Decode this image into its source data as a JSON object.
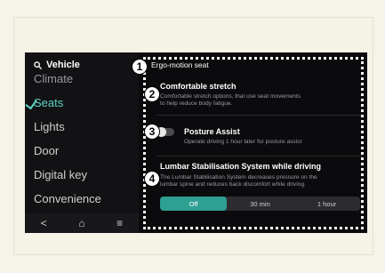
{
  "sidebar": {
    "header": "Vehicle",
    "items": [
      {
        "label": "Climate",
        "active": false
      },
      {
        "label": "Seats",
        "active": true
      },
      {
        "label": "Lights",
        "active": false
      },
      {
        "label": "Door",
        "active": false
      },
      {
        "label": "Digital key",
        "active": false
      },
      {
        "label": "Convenience",
        "active": false
      }
    ],
    "bottom": {
      "back": "<",
      "home": "⌂",
      "menu": "≡"
    }
  },
  "main": {
    "page_title": "Ergo-motion seat",
    "markers": [
      "1",
      "2",
      "3",
      "4"
    ],
    "comfortable_stretch": {
      "title": "Comfortable stretch",
      "desc_line1": "Comfortable stretch options, that use seat movements",
      "desc_line2": "to help reduce body fatigue."
    },
    "posture_assist": {
      "title": "Posture Assist",
      "desc": "Operate driving 1 hour later for posture assist",
      "enabled": false
    },
    "lumbar": {
      "title": "Lumbar Stabilisation System while driving",
      "desc_line1": "The Lumbar Stabilisation System decreases pressure on the",
      "desc_line2": "lumbar spine and reduces back discomfort while driving.",
      "options": [
        "Off",
        "30 min",
        "1 hour"
      ],
      "selected": "Off"
    }
  },
  "colors": {
    "accent": "#2e9f93",
    "active_text": "#5fd6c6",
    "background": "#0b0b0d"
  }
}
